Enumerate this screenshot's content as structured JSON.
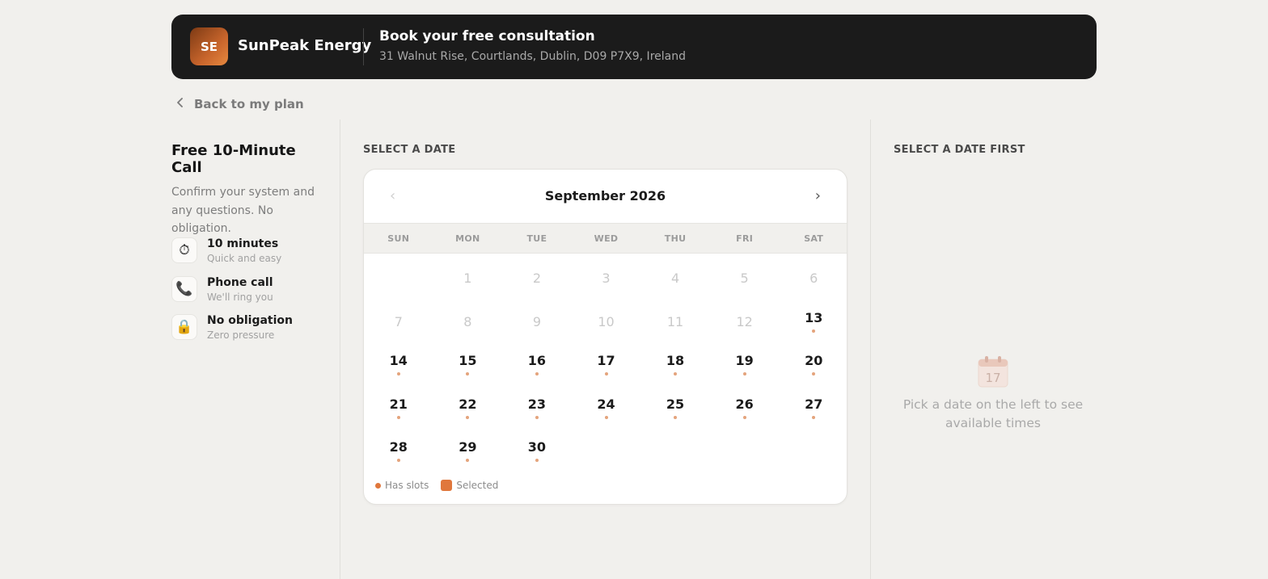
{
  "header": {
    "logo_initials": "SE",
    "brand": "SunPeak Energy",
    "title": "Book your free consultation",
    "address": "31 Walnut Rise, Courtlands, Dublin, D09 P7X9, Ireland"
  },
  "back_link": {
    "label": "Back to my plan"
  },
  "summary": {
    "title": "Free 10-Minute Call",
    "description": "Confirm your system and any questions. No obligation.",
    "features": [
      {
        "icon": "stopwatch-icon",
        "glyph": "⏱",
        "title": "10 minutes",
        "subtitle": "Quick and easy"
      },
      {
        "icon": "phone-icon",
        "glyph": "📞",
        "title": "Phone call",
        "subtitle": "We'll ring you"
      },
      {
        "icon": "lock-icon",
        "glyph": "🔒",
        "title": "No obligation",
        "subtitle": "Zero pressure"
      }
    ]
  },
  "date_section": {
    "label": "SELECT A DATE"
  },
  "calendar": {
    "month_label": "September 2026",
    "prev_glyph": "‹",
    "next_glyph": "›",
    "weekdays": [
      "SUN",
      "MON",
      "TUE",
      "WED",
      "THU",
      "FRI",
      "SAT"
    ],
    "first_weekday_index": 1,
    "days_in_month": 30,
    "first_available_day": 13,
    "legend": {
      "has_slots": "Has slots",
      "selected": "Selected"
    }
  },
  "time_section": {
    "label": "SELECT A DATE FIRST",
    "empty_icon_number": "17",
    "empty_text": "Pick a date on the left to see available times"
  },
  "colors": {
    "accent": "#e0773c",
    "slot_dot": "#e4a47c",
    "header_bg": "#1b1b1b",
    "page_bg": "#f1f0ed"
  }
}
